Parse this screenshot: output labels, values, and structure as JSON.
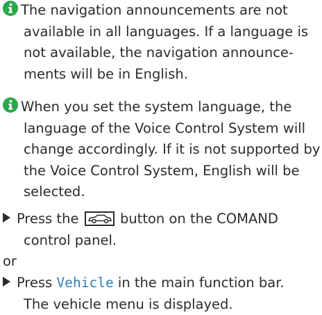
{
  "info_notes": [
    {
      "lines": [
        "The navigation announcements are not",
        "available in all languages. If a language is",
        "not available, the navigation announce-",
        "ments will be in English."
      ]
    },
    {
      "lines": [
        "When you set the system language, the",
        "language of the Voice Control System will",
        "change accordingly. If it is not supported by",
        "the Voice Control System, English will be",
        "selected."
      ]
    }
  ],
  "step1": {
    "before_button": "Press the",
    "after_button": "button on the COMAND",
    "line2": "control panel."
  },
  "or_text": "or",
  "step2": {
    "before_term": "Press",
    "term": "Vehicle",
    "after_term": "in the main function bar.",
    "line2": "The vehicle menu is displayed."
  },
  "colors": {
    "info_icon": "#2aa84a",
    "term_highlight": "#2f7fb8",
    "text": "#2b2b2b"
  },
  "icons": {
    "info": "info-circle-icon",
    "bullet": "triangle-arrow-icon",
    "vehicle_button": "car-icon"
  }
}
